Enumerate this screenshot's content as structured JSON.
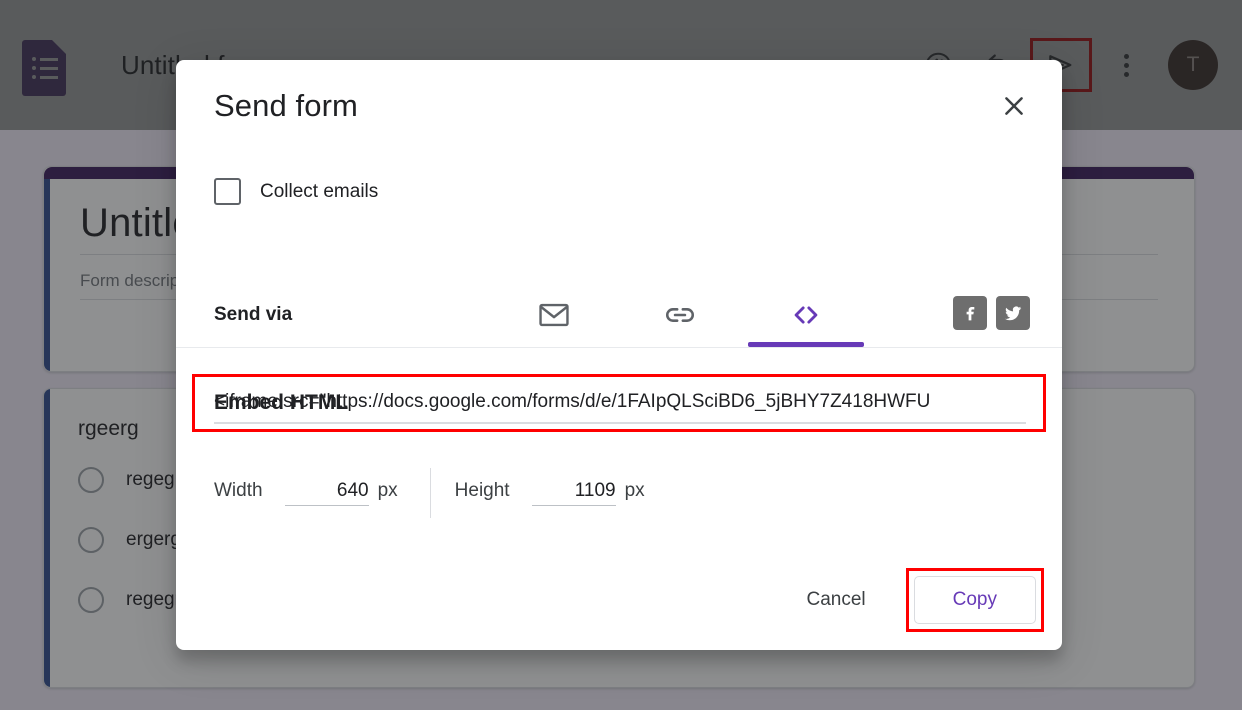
{
  "header": {
    "logo_icon": "google-forms-icon",
    "form_title": "Untitled form",
    "theme_icon": "palette-icon",
    "undo_icon": "undo-icon",
    "send_icon": "send-icon",
    "more_icon": "more-vert-icon",
    "avatar_initial": "T",
    "avatar_color": "#4b342c"
  },
  "background_form": {
    "title": "Untitled form",
    "description_placeholder": "Form description",
    "question": {
      "title": "rgeerg",
      "options": [
        "regeg",
        "ergerg",
        "regegrege"
      ]
    },
    "accent_color": "#2f4b8f",
    "header_bar_color": "#3b1a5c"
  },
  "dialog": {
    "title": "Send form",
    "close_icon": "close-icon",
    "collect_emails": {
      "label": "Collect emails",
      "checked": false
    },
    "send_via": {
      "label": "Send via",
      "tabs": [
        {
          "id": "email",
          "icon": "email-icon",
          "active": false
        },
        {
          "id": "link",
          "icon": "link-icon",
          "active": false
        },
        {
          "id": "embed",
          "icon": "embed-code-icon",
          "active": true
        }
      ],
      "active_color": "#673ab7",
      "socials": [
        {
          "id": "facebook",
          "icon": "facebook-icon"
        },
        {
          "id": "twitter",
          "icon": "twitter-icon"
        }
      ]
    },
    "embed": {
      "label": "Embed HTML",
      "value": "<iframe src=\"https://docs.google.com/forms/d/e/1FAIpQLSciBD6_5jBHY7Z418HWFU",
      "highlight_color": "#ff0000"
    },
    "dimensions": {
      "width_label": "Width",
      "width_value": "640",
      "width_unit": "px",
      "height_label": "Height",
      "height_value": "1109",
      "height_unit": "px"
    },
    "actions": {
      "cancel_label": "Cancel",
      "copy_label": "Copy"
    }
  }
}
